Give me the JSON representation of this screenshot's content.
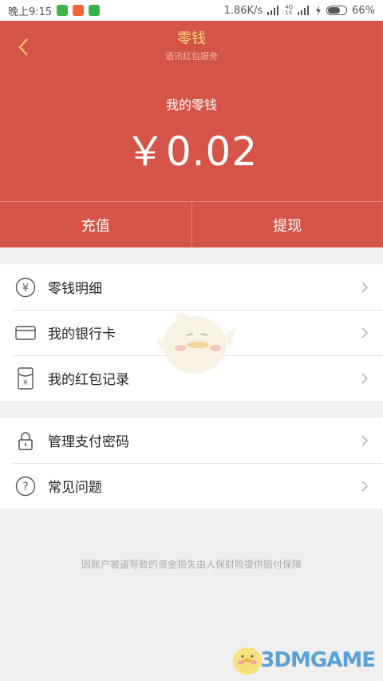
{
  "status_bar": {
    "time": "晚上9:15",
    "network_speed": "1.86K/s",
    "battery_percent": "66%",
    "battery_level": 0.66,
    "signal_tags": [
      "4G",
      "1X"
    ]
  },
  "header": {
    "title": "零钱",
    "subtitle": "语讯红包服务",
    "balance_label": "我的零钱",
    "balance_amount": "￥0.02",
    "background_color": "#d45447",
    "title_color": "#f7d679"
  },
  "actions": {
    "recharge": "充值",
    "withdraw": "提现"
  },
  "menu_group_1": [
    {
      "label": "零钱明细",
      "icon": "yuan-coin-icon"
    },
    {
      "label": "我的银行卡",
      "icon": "bank-card-icon"
    },
    {
      "label": "我的红包记录",
      "icon": "red-packet-icon"
    }
  ],
  "menu_group_2": [
    {
      "label": "管理支付密码",
      "icon": "lock-icon"
    },
    {
      "label": "常见问题",
      "icon": "question-icon"
    }
  ],
  "footer_note": "因账户被盗导致的资金损失由人保财险提供赔付保障",
  "watermark": "3DMGAME"
}
